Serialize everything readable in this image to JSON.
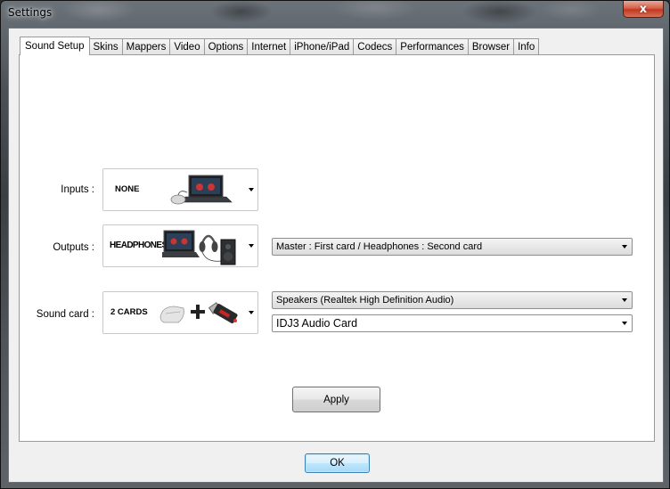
{
  "window": {
    "title": "Settings",
    "close_label": "x"
  },
  "tabs": [
    {
      "label": "Sound Setup",
      "active": true
    },
    {
      "label": "Skins"
    },
    {
      "label": "Mappers"
    },
    {
      "label": "Video"
    },
    {
      "label": "Options"
    },
    {
      "label": "Internet"
    },
    {
      "label": "iPhone/iPad"
    },
    {
      "label": "Codecs"
    },
    {
      "label": "Performances"
    },
    {
      "label": "Browser"
    },
    {
      "label": "Info"
    }
  ],
  "sound_setup": {
    "inputs": {
      "label": "Inputs :",
      "value": "NONE"
    },
    "outputs": {
      "label": "Outputs :",
      "value": "HEADPHONES",
      "mode": "Master : First card / Headphones : Second card"
    },
    "sound_card": {
      "label": "Sound card :",
      "value": "2 CARDS",
      "card1": "Speakers (Realtek High Definition Audio)",
      "card2": "IDJ3 Audio Card"
    },
    "apply_label": "Apply"
  },
  "footer": {
    "ok_label": "OK"
  },
  "colors": {
    "close_button": "#c0391f",
    "panel_bg": "#ffffff",
    "client_bg": "#f0f0f0"
  }
}
